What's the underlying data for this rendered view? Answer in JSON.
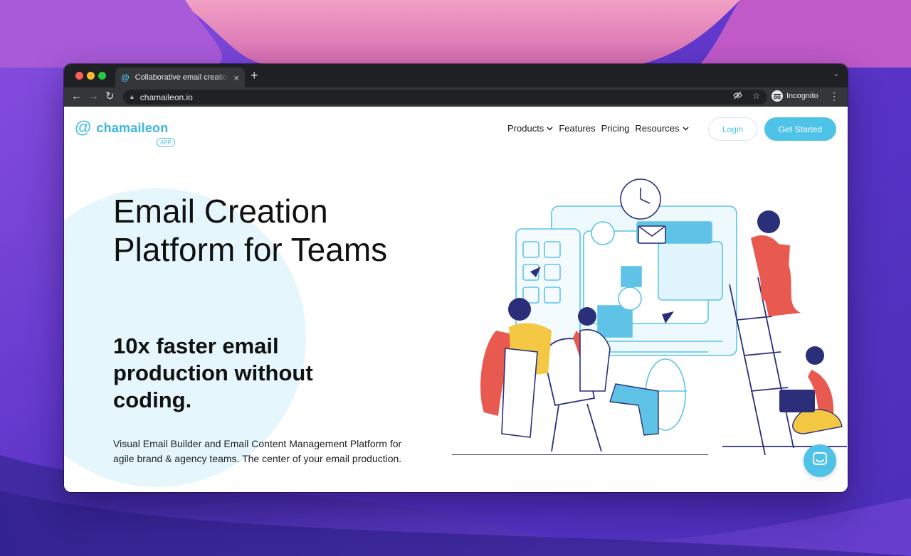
{
  "browser": {
    "tab_title": "Collaborative email creation pl",
    "tab_favicon": "@",
    "url": "chamaileon.io",
    "profile_label": "Incognito",
    "new_tab_glyph": "+",
    "close_glyph": "×"
  },
  "site": {
    "logo_text": "chamaileon",
    "logo_badge": "APP",
    "nav": {
      "products": "Products",
      "features": "Features",
      "pricing": "Pricing",
      "resources": "Resources"
    },
    "login_label": "Login",
    "cta_label": "Get Started"
  },
  "hero": {
    "title": "Email Creation Platform for Teams",
    "subtitle": "10x faster email production without coding.",
    "description": "Visual Email Builder and Email Content Management Platform for agile brand & agency teams. The center of your email production."
  },
  "colors": {
    "accent": "#4fc2e8",
    "text": "#111111"
  },
  "icons": [
    "back-icon",
    "forward-icon",
    "reload-icon",
    "lock-icon",
    "eye-off-icon",
    "star-icon",
    "incognito-icon",
    "menu-icon",
    "chevron-down-icon",
    "chat-icon"
  ]
}
